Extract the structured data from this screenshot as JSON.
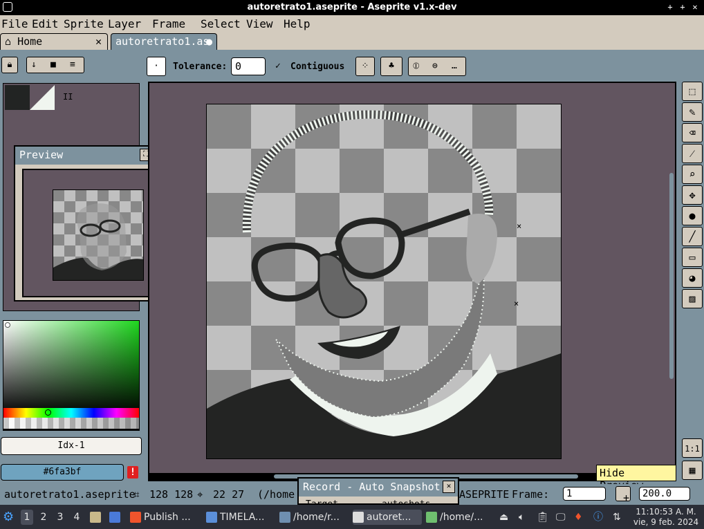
{
  "window": {
    "title": "autoretrato1.aseprite - Aseprite v1.x-dev"
  },
  "menu": [
    "File",
    "Edit",
    "Sprite",
    "Layer",
    "Frame",
    "Select",
    "View",
    "Help"
  ],
  "tabs": [
    {
      "label": "Home",
      "close": "✕"
    },
    {
      "label": "autoretrato1.as",
      "modified": "●"
    }
  ],
  "toolbar": {
    "tolerance_label": "Tolerance:",
    "tolerance_value": "0",
    "contiguous_label": "Contiguous"
  },
  "palette": {
    "index_label": "Idx-1",
    "hex_value": "#6fa3bf",
    "warning": "!",
    "pause": "II"
  },
  "preview": {
    "title": "Preview"
  },
  "status": {
    "filename": "autoretrato1.aseprite",
    "size": "128 128",
    "pos": "22 27",
    "path": "(/home",
    "tail": "ASEPRITE",
    "frame_label": "Frame:",
    "frame_value": "1",
    "zoom": "200.0"
  },
  "record": {
    "title": "Record - Auto Snapshot",
    "row": "Target",
    "row_value": "autoshots"
  },
  "tooltip": "Hide Preview",
  "taskbar": {
    "workspaces": [
      "1",
      "2",
      "3",
      "4"
    ],
    "tasks": [
      "Publish ...",
      "TIMELA...",
      "/home/r...",
      "autoret...",
      "/home/..."
    ],
    "time": "11:10:53 A. M.",
    "date": "vie, 9 feb. 2024"
  },
  "colors": {
    "accent": "#6fa3bf",
    "canvas_bg": "#625560",
    "ui_bg": "#7d929e",
    "panel": "#d3cbbe"
  }
}
